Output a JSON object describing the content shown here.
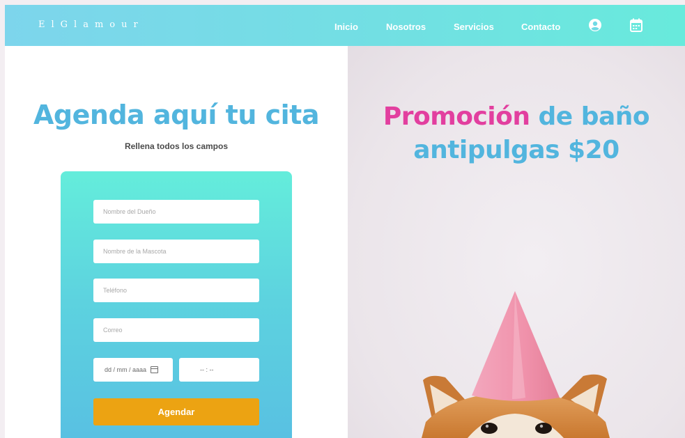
{
  "nav": {
    "brand": "ElGlamour",
    "links": [
      "Inicio",
      "Nosotros",
      "Servicios",
      "Contacto"
    ],
    "icons": [
      "user-circle-icon",
      "calendar-icon"
    ]
  },
  "form": {
    "title": "Agenda aquí tu cita",
    "subtitle": "Rellena todos los campos",
    "fields": [
      {
        "placeholder": "Nombre del Dueño"
      },
      {
        "placeholder": "Nombre de la Mascota"
      },
      {
        "placeholder": "Teléfono"
      },
      {
        "placeholder": "Correo"
      }
    ],
    "date_value": "dd / mm / aaaa",
    "time_value": "-- : --",
    "submit_label": "Agendar"
  },
  "promo": {
    "highlight": "Promoción",
    "rest": " de baño antipulgas $20"
  },
  "colors": {
    "accent_blue": "#52b5de",
    "accent_pink": "#e23f9f",
    "button_orange": "#eca312",
    "nav_teal": "#68eadc"
  }
}
